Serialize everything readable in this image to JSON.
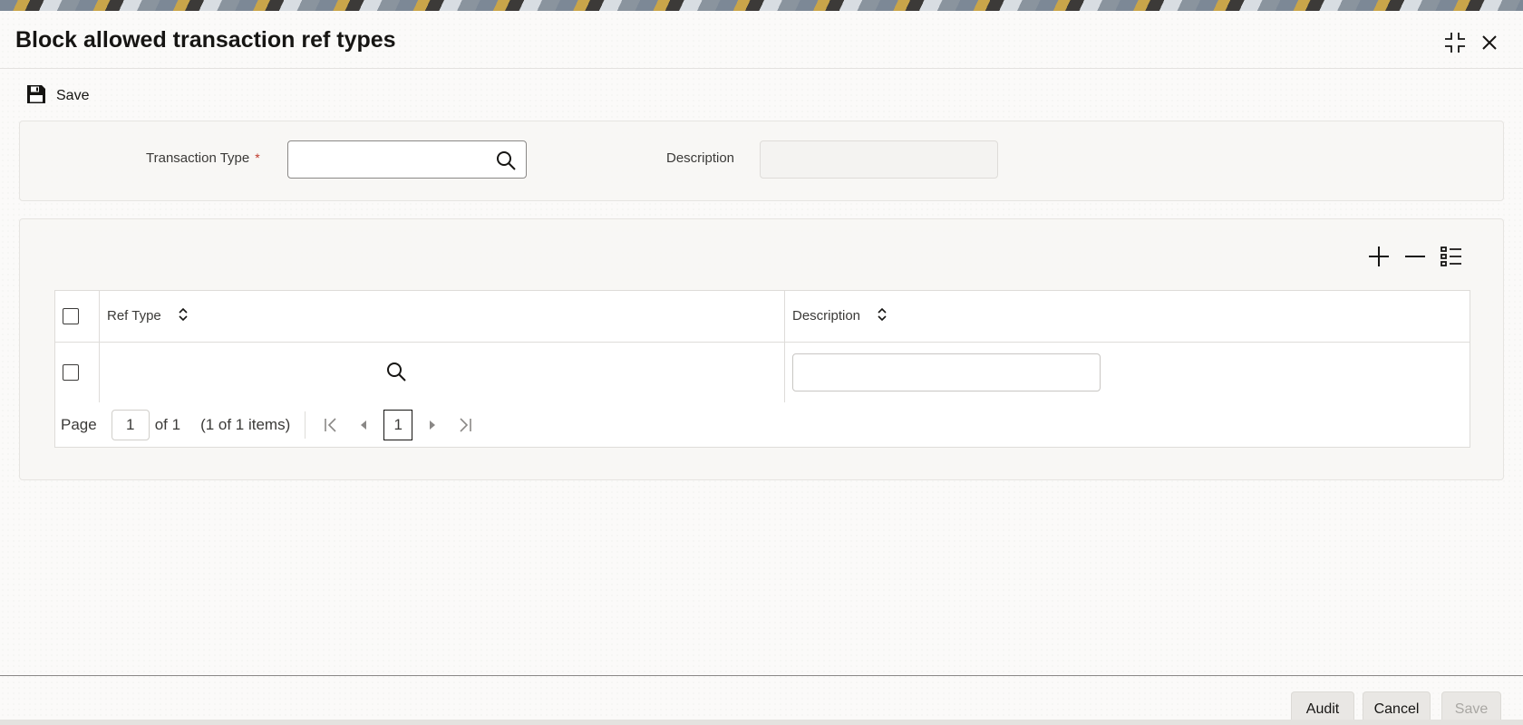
{
  "dialog": {
    "title": "Block allowed transaction ref types"
  },
  "toolbar": {
    "save_label": "Save"
  },
  "form": {
    "transaction_type_label": "Transaction Type",
    "required_marker": "*",
    "transaction_type_value": "",
    "description_label": "Description",
    "description_value": ""
  },
  "grid": {
    "columns": [
      "Ref Type",
      "Description"
    ],
    "rows": [
      {
        "ref_type": "",
        "description": ""
      }
    ]
  },
  "pager": {
    "page_label": "Page",
    "current_page": "1",
    "of_label": "of 1",
    "items_label": "(1 of 1 items)",
    "current_page_button": "1"
  },
  "footer": {
    "audit_label": "Audit",
    "cancel_label": "Cancel",
    "save_label": "Save"
  },
  "icons": {
    "save": "save-icon",
    "collapse": "collapse-icon",
    "close": "close-icon",
    "search": "search-icon",
    "add": "plus-icon",
    "remove": "minus-icon",
    "columns": "list-icon",
    "sort": "sort-icon",
    "first": "first-page-icon",
    "prev": "prev-page-icon",
    "next": "next-page-icon",
    "last": "last-page-icon"
  },
  "colors": {
    "required": "#c0392b",
    "text": "#161513"
  }
}
